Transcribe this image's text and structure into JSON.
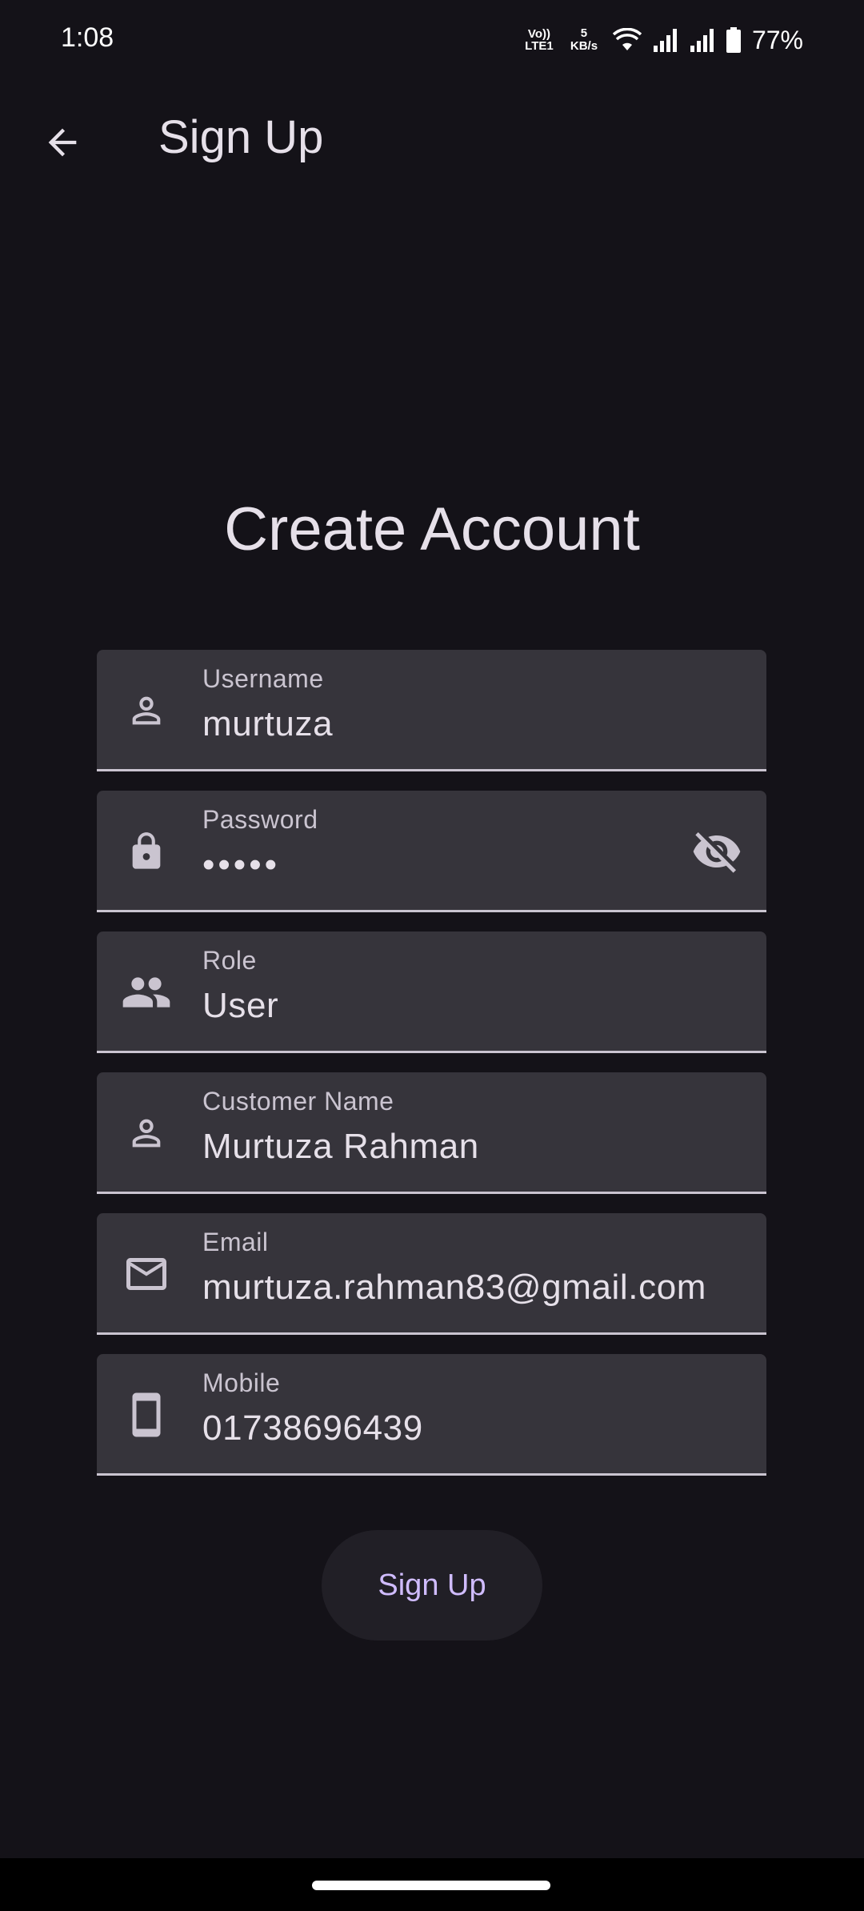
{
  "status_bar": {
    "time": "1:08",
    "volte_line1": "Vo))",
    "volte_line2": "LTE1",
    "speed_value": "5",
    "speed_unit": "KB/s",
    "battery": "77%"
  },
  "app_bar": {
    "title": "Sign Up",
    "back_icon": "arrow-back-icon"
  },
  "heading": "Create Account",
  "fields": [
    {
      "label": "Username",
      "value": "murtuza",
      "icon": "person-outline-icon"
    },
    {
      "label": "Password",
      "value": "•••••",
      "icon": "lock-icon",
      "trailing_icon": "visibility-off-icon"
    },
    {
      "label": "Role",
      "value": "User",
      "icon": "group-icon"
    },
    {
      "label": "Customer Name",
      "value": "Murtuza Rahman",
      "icon": "person-outline-icon"
    },
    {
      "label": "Email",
      "value": "murtuza.rahman83@gmail.com",
      "icon": "mail-outline-icon"
    },
    {
      "label": "Mobile",
      "value": "01738696439",
      "icon": "smartphone-icon"
    }
  ],
  "signup_button": "Sign Up",
  "colors": {
    "background": "#141218",
    "field_background": "#36343B",
    "accent": "#D0BCFF",
    "on_surface": "#E6E0E9",
    "label": "#CAC4D0"
  }
}
